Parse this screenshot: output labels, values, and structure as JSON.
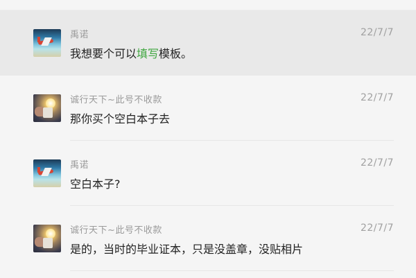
{
  "messages": [
    {
      "sender": "禹诺",
      "time": "22/7/7",
      "text_before": "我想要个可以",
      "text_highlight": "填写",
      "text_after": "模板。",
      "avatar": "plane-avatar",
      "highlighted": true
    },
    {
      "sender": "诚行天下~此号不收款",
      "time": "22/7/7",
      "text_before": "那你买个空白本子去",
      "text_highlight": "",
      "text_after": "",
      "avatar": "cup-avatar",
      "highlighted": false
    },
    {
      "sender": "禹诺",
      "time": "22/7/7",
      "text_before": "空白本子?",
      "text_highlight": "",
      "text_after": "",
      "avatar": "plane-avatar",
      "highlighted": false
    },
    {
      "sender": "诚行天下~此号不收款",
      "time": "22/7/7",
      "text_before": "是的，当时的毕业证本，只是没盖章，没贴相片",
      "text_highlight": "",
      "text_after": "",
      "avatar": "cup-avatar",
      "highlighted": false
    }
  ],
  "colors": {
    "background": "#f5f5f5",
    "highlight_row": "#e9e9e9",
    "keyword": "#3fa63f"
  }
}
